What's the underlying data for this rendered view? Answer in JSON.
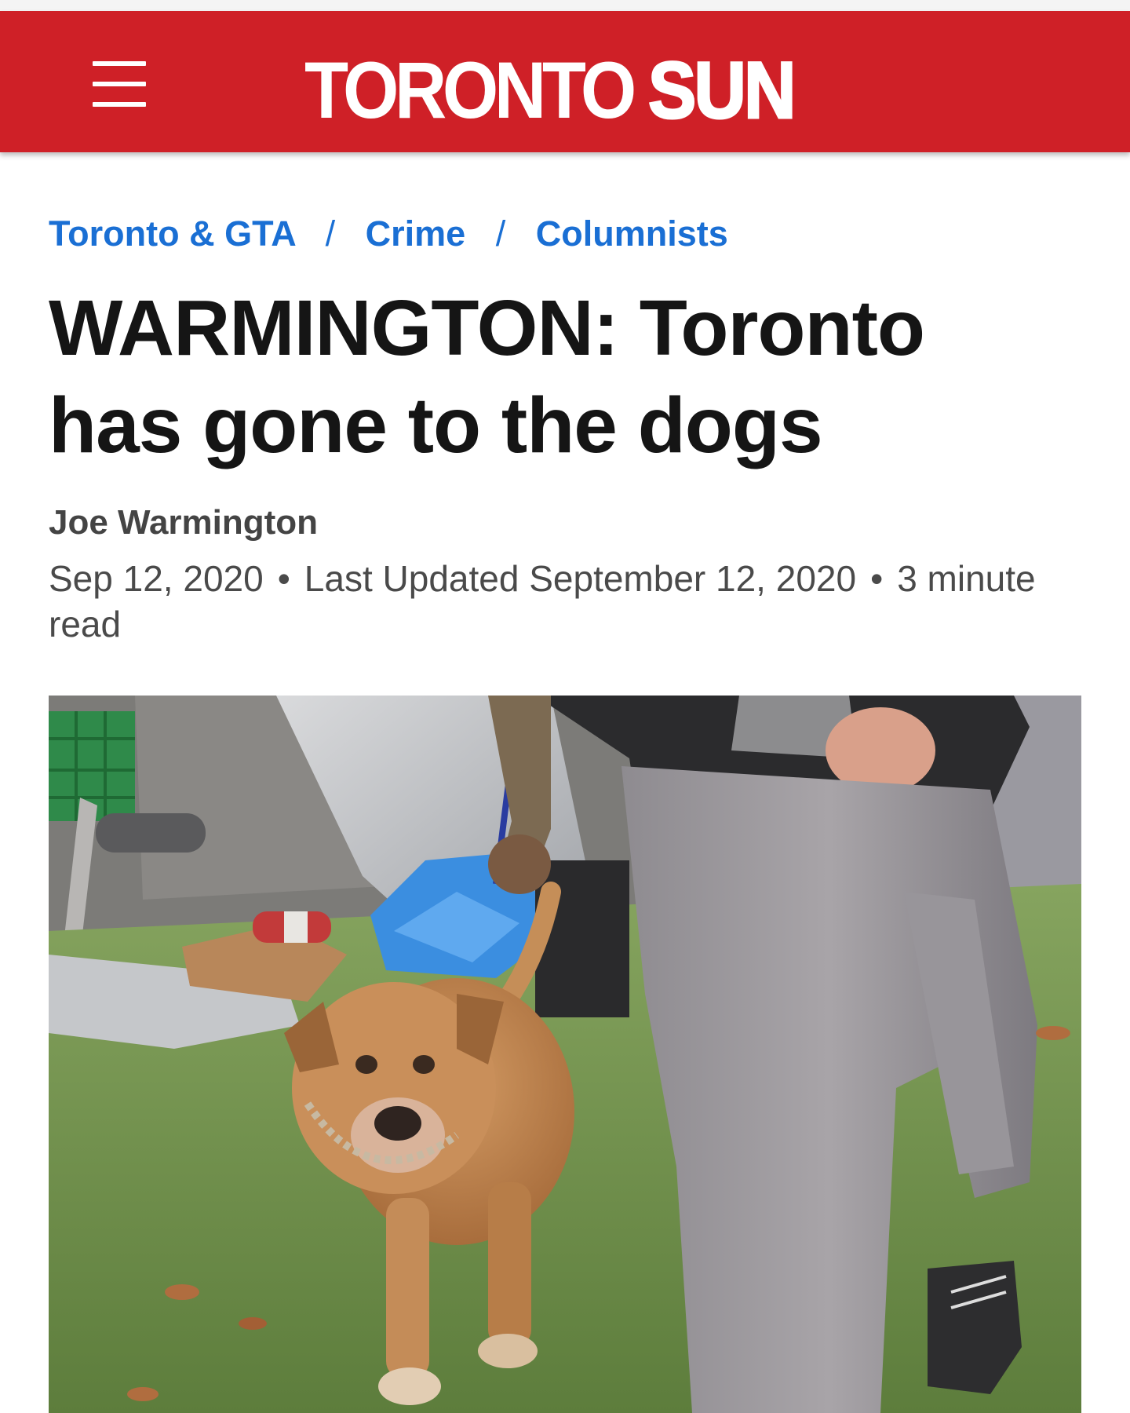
{
  "header": {
    "logo_part1": "TORONTO",
    "logo_part2": "SUN",
    "menu_icon": "hamburger-menu-icon",
    "brand_color": "#cf2027"
  },
  "breadcrumb": {
    "items": [
      "Toronto & GTA",
      "Crime",
      "Columnists"
    ],
    "separator": "/",
    "link_color": "#1a6fd4"
  },
  "article": {
    "headline": "WARMINGTON: Toronto has gone to the dogs",
    "author": "Joe Warmington",
    "date": "Sep 12, 2020",
    "updated": "Last Updated September 12, 2020",
    "read_time": "3 minute read",
    "meta_separator": "•"
  },
  "hero_image": {
    "subject": "tan dog on a leash walking beside a man in grey pants past tents on grass"
  }
}
